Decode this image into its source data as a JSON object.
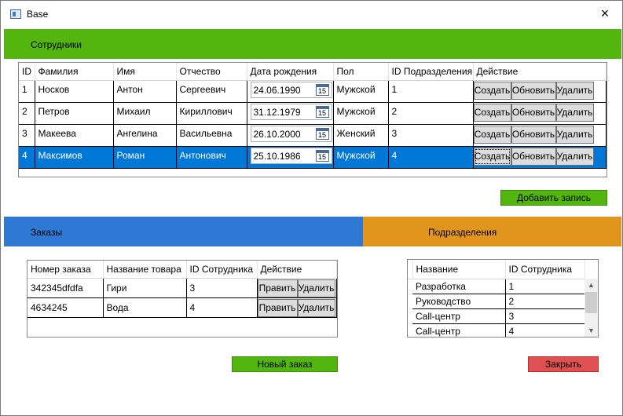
{
  "window": {
    "title": "Base",
    "close_icon": "×"
  },
  "employees": {
    "section_title": "Сотрудники",
    "columns": [
      "ID",
      "Фамилия",
      "Имя",
      "Отчество",
      "Дата рождения",
      "Пол",
      "ID Подразделения",
      "Действие"
    ],
    "rows": [
      {
        "id": "1",
        "last": "Носков",
        "first": "Антон",
        "middle": "Сергеевич",
        "birth": "24.06.1990",
        "gender": "Мужской",
        "dept": "1"
      },
      {
        "id": "2",
        "last": "Петров",
        "first": "Михаил",
        "middle": "Кириллович",
        "birth": "31.12.1979",
        "gender": "Мужской",
        "dept": "2"
      },
      {
        "id": "3",
        "last": "Макеева",
        "first": "Ангелина",
        "middle": "Васильевна",
        "birth": "26.10.2000",
        "gender": "Женский",
        "dept": "3"
      },
      {
        "id": "4",
        "last": "Максимов",
        "first": "Роман",
        "middle": "Антонович",
        "birth": "25.10.1986",
        "gender": "Мужской",
        "dept": "4"
      }
    ],
    "calendar_day": "15",
    "selected_row": 4,
    "create_label": "Создать",
    "update_label": "Обновить",
    "delete_label": "Удалить",
    "add_label": "Добавить запись"
  },
  "orders": {
    "section_title": "Заказы",
    "columns": [
      "Номер заказа",
      "Название товара",
      "ID Сотрудника",
      "Действие"
    ],
    "rows": [
      {
        "number": "342345dfdfa",
        "product": "Гири",
        "employee": "3"
      },
      {
        "number": "4634245",
        "product": "Вода",
        "employee": "4"
      }
    ],
    "edit_label": "Править",
    "delete_label": "Удалить",
    "new_label": "Новый заказ"
  },
  "departments": {
    "section_title": "Подразделения",
    "columns": [
      "Название",
      "ID Сотрудника"
    ],
    "rows": [
      {
        "name": "Разработка",
        "employee": "1"
      },
      {
        "name": "Руководство",
        "employee": "2"
      },
      {
        "name": "Call-центр",
        "employee": "3"
      },
      {
        "name": "Call-центр",
        "employee": "4"
      }
    ],
    "scroll_up_icon": "▲",
    "scroll_down_icon": "▼"
  },
  "close_label": "Закрыть",
  "colors": {
    "green": "#52b60f",
    "blue": "#2f78d4",
    "orange": "#e2951c",
    "red": "#e05050",
    "selection": "#0078d7"
  }
}
